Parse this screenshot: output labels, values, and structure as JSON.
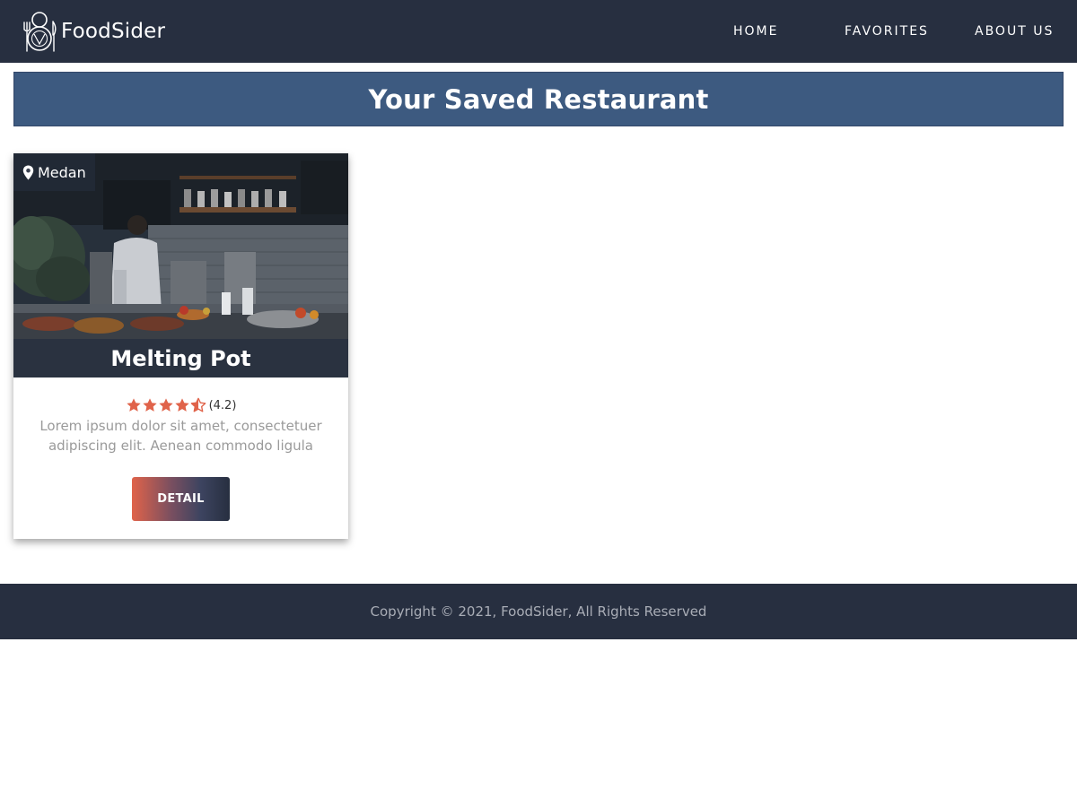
{
  "header": {
    "brand_name": "FoodSider",
    "logo_icon": "fork-plate-knife-logo",
    "nav": {
      "home": "HOME",
      "favorites": "FAVORITES",
      "about": "ABOUT US"
    }
  },
  "main": {
    "title": "Your Saved Restaurant",
    "restaurants": [
      {
        "city": "Medan",
        "name": "Melting Pot",
        "rating": 4.2,
        "rating_text": "(4.2)",
        "description": "Lorem ipsum dolor sit amet, consectetuer adipiscing elit. Aenean commodo ligula",
        "detail_label": "DETAIL"
      }
    ]
  },
  "footer": {
    "copyright": "Copyright © 2021, FoodSider, All Rights Reserved"
  },
  "colors": {
    "navbar": "#272f40",
    "title_bar": "#3d5a80",
    "accent": "#e0634a",
    "muted_text": "#9a9a9a"
  }
}
